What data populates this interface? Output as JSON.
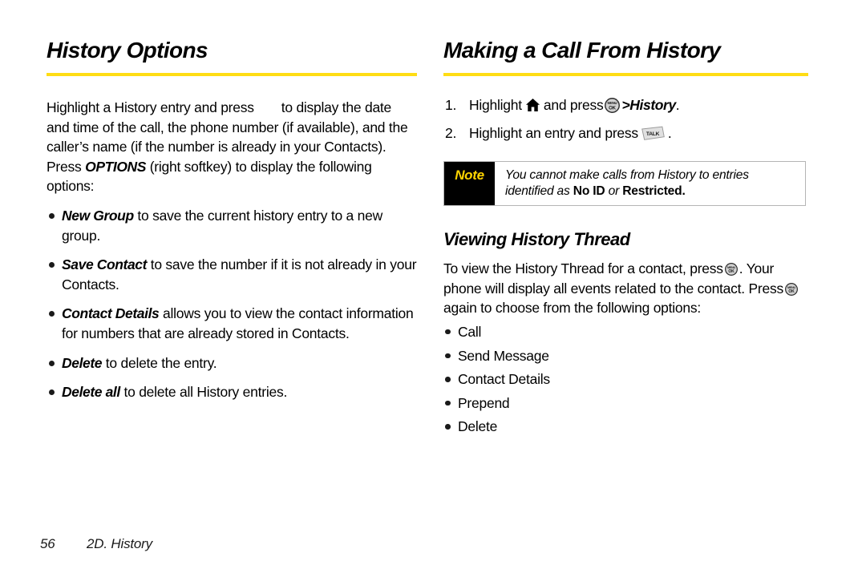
{
  "left_column": {
    "title": "History Options",
    "intro": {
      "part1": "Highlight a History entry and press",
      "part2": "to display the date and time of the call, the phone number (if available), and the caller’s name (if the number is already in your Contacts). Press",
      "options_word": "OPTIONS",
      "part3": "(right softkey) to display the following options:"
    },
    "options": [
      {
        "term": "New Group",
        "text": "to save the current history entry to a new group."
      },
      {
        "term": "Save Contact",
        "text": "to save the number if it is not already in your Contacts."
      },
      {
        "term": "Contact Details",
        "text": "allows you to view the contact information for numbers that are already stored in Contacts."
      },
      {
        "term": "Delete",
        "text": "to delete the entry."
      },
      {
        "term": "Delete all",
        "text": "to delete all History entries."
      }
    ]
  },
  "right_column": {
    "title": "Making a Call From History",
    "steps": [
      {
        "text_before_home": "Highlight",
        "home_icon": "home-icon",
        "text_after_home": "and press",
        "menuok_icon": "menu-ok-key-icon",
        "emphasis": ">History",
        "text_end": "."
      },
      {
        "text_before_talk": "Highlight an entry and press",
        "talk_icon": "talk-key-icon",
        "text_end": "."
      }
    ],
    "note": {
      "label": "Note",
      "text_part1": "You cannot make calls from History to entries identified as ",
      "bold1": "No ID",
      "text_part2": " or ",
      "bold2": "Restricted",
      "text_part3": "."
    },
    "subsection": {
      "title": "Viewing History Thread",
      "body_part1": "To view the History Thread for a contact, press",
      "body_part2": ". Your phone will display all events related to the contact. Press",
      "body_part3": "again to choose from the following options:",
      "options": [
        "Call",
        "Send Message",
        "Contact Details",
        "Prepend",
        "Delete"
      ]
    }
  },
  "footer": {
    "page_number": "56",
    "chapter": "2D. History"
  },
  "icon_labels": {
    "menu_top": "MENU",
    "menu_bottom": "OK",
    "talk": "TALK"
  },
  "colors": {
    "accent_yellow": "#ffdd14",
    "note_tab_bg": "#000000",
    "note_label": "#ffd400"
  }
}
